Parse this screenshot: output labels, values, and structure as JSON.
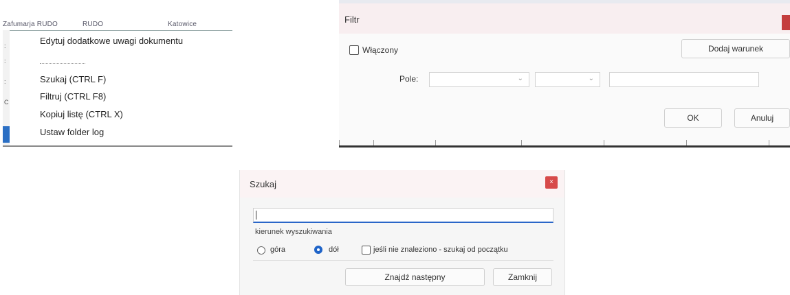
{
  "context_menu": {
    "header_cells": [
      "Zafumarja RUDO",
      "RUDO",
      "Katowice"
    ],
    "items": [
      "Edytuj dodatkowe uwagi dokumentu",
      "Szukaj (CTRL F)",
      "Filtruj (CTRL F8)",
      "Kopiuj listę (CTRL X)",
      "Ustaw folder log"
    ]
  },
  "filtr_dialog": {
    "title": "Filtr",
    "enabled_label": "Włączony",
    "enabled_checked": false,
    "add_condition_button": "Dodaj warunek",
    "field_label": "Pole:",
    "field_value": "",
    "operator_value": "",
    "condition_value": "",
    "ok_button": "OK",
    "cancel_button": "Anuluj"
  },
  "szukaj_dialog": {
    "title": "Szukaj",
    "close_symbol": "×",
    "search_value": "",
    "direction_group_label": "kierunek wyszukiwania",
    "radio_up": "góra",
    "radio_down": "dół",
    "selected_direction": "dół",
    "wrap_checkbox": "jeśli nie znaleziono - szukaj od początku",
    "wrap_checked": false,
    "find_next_button": "Znajdź następny",
    "close_button": "Zamknij"
  },
  "colors": {
    "accent_blue": "#2a66c8",
    "close_red": "#d74a4a",
    "titlebar_pink": "#fbf3f4"
  }
}
